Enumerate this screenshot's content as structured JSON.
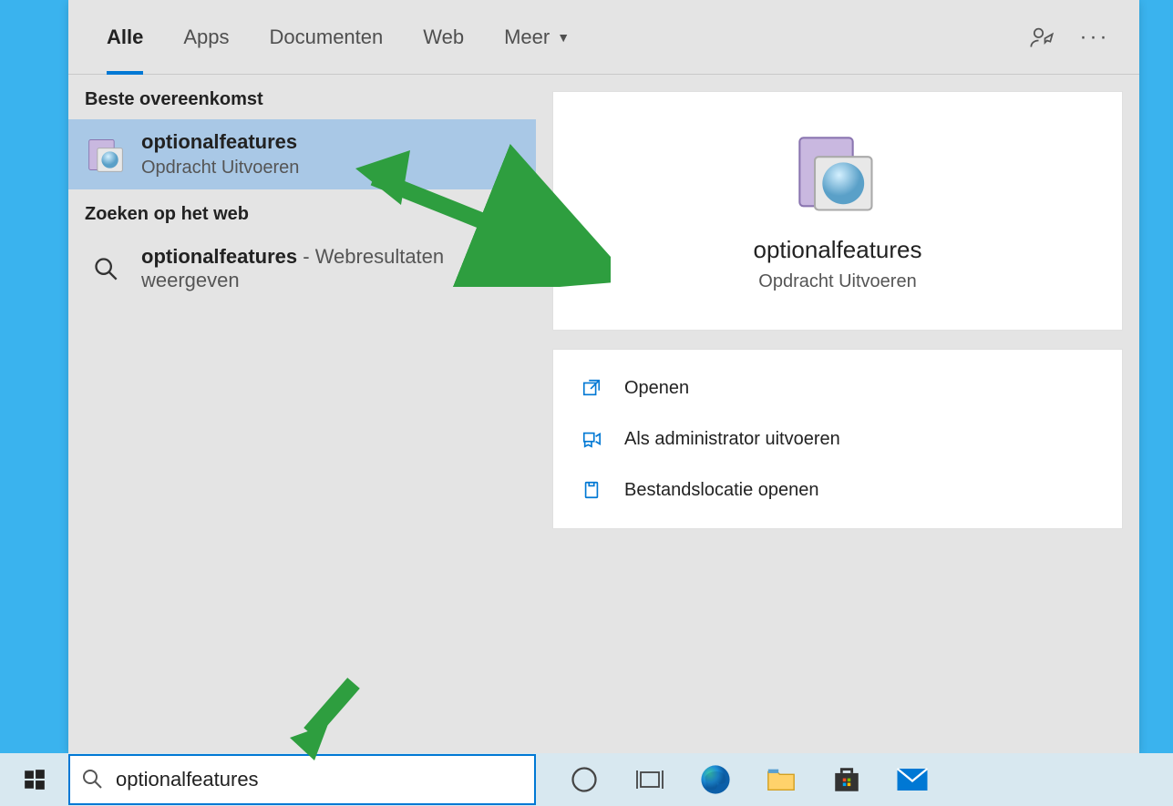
{
  "tabs": {
    "all": "Alle",
    "apps": "Apps",
    "documents": "Documenten",
    "web": "Web",
    "more": "Meer"
  },
  "sections": {
    "best_match": "Beste overeenkomst",
    "web_search": "Zoeken op het web"
  },
  "best_match": {
    "title": "optionalfeatures",
    "subtitle": "Opdracht Uitvoeren"
  },
  "web_result": {
    "bold": "optionalfeatures",
    "rest": " - Webresultaten weergeven"
  },
  "detail": {
    "title": "optionalfeatures",
    "subtitle": "Opdracht Uitvoeren"
  },
  "actions": {
    "open": "Openen",
    "run_admin": "Als administrator uitvoeren",
    "open_location": "Bestandslocatie openen"
  },
  "searchbox": {
    "value": "optionalfeatures",
    "placeholder": ""
  }
}
